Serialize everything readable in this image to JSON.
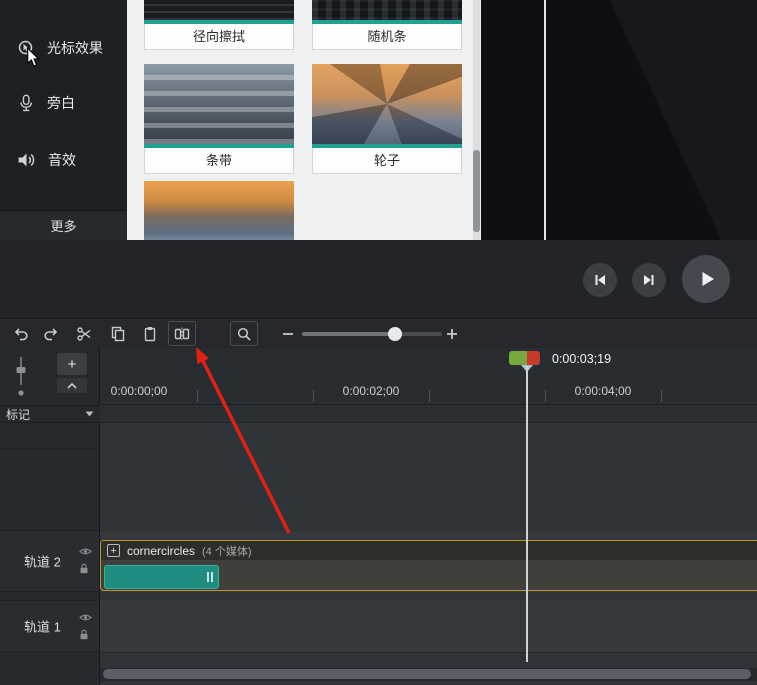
{
  "sidebar": {
    "items": [
      {
        "label": "光标效果"
      },
      {
        "label": "旁白"
      },
      {
        "label": "音效"
      }
    ],
    "more_label": "更多"
  },
  "transitions": {
    "items": [
      {
        "name": "径向擦拭"
      },
      {
        "name": "随机条"
      },
      {
        "name": "条带"
      },
      {
        "name": "轮子"
      },
      {
        "name": ""
      }
    ]
  },
  "timeline": {
    "current_time": "0:00:03;19",
    "ruler_labels": [
      "0:00:00;00",
      "0:00:02;00",
      "0:00:04;00"
    ],
    "marker_label": "标记",
    "add_track_label": "+",
    "tracks": [
      {
        "name": "轨道 2"
      },
      {
        "name": "轨道 1"
      }
    ],
    "group": {
      "plus": "+",
      "name": "cornercircles",
      "count": "(4 个媒体)"
    }
  },
  "colors": {
    "accent_teal": "#1fa292",
    "group_border": "#bf992b",
    "playhead_green": "#77a943",
    "playhead_red": "#c63b2e",
    "annotation_arrow": "#e02214"
  }
}
